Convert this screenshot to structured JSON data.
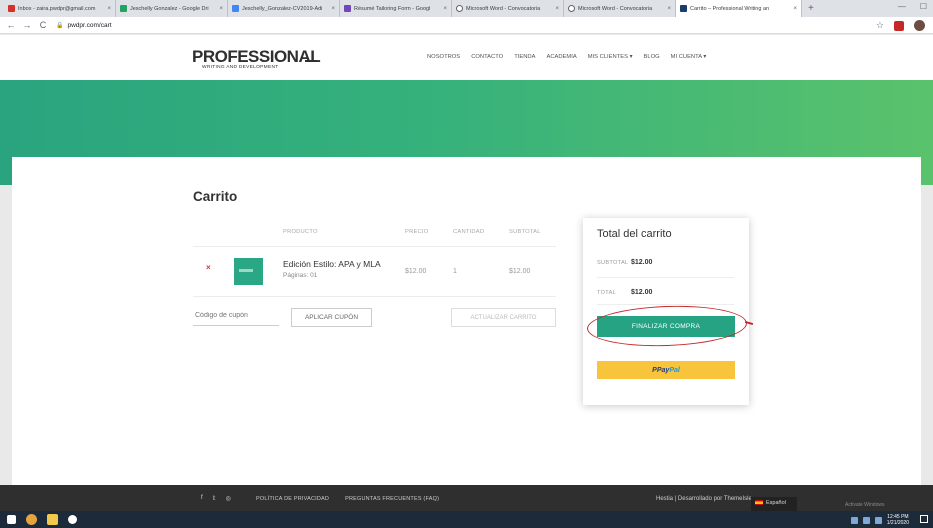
{
  "browser": {
    "tabs": [
      {
        "label": "Inbox - zaira.pwdpr@gmail.com",
        "color": "#d93025",
        "active": false
      },
      {
        "label": "Jeschelly Gonzalez - Google Dri",
        "color": "#1fa463",
        "active": false
      },
      {
        "label": "Jeschelly_Gonzalez-CV2019-Adi",
        "color": "#4285f4",
        "active": false
      },
      {
        "label": "Résumé Tailoring Form - Googl",
        "color": "#7248b9",
        "active": false
      },
      {
        "label": "Microsoft Word - Convocatoria",
        "color": "#5f6368",
        "active": false
      },
      {
        "label": "Microsoft Word - Convocatoria",
        "color": "#5f6368",
        "active": false
      },
      {
        "label": "Carrito – Professional Writing an",
        "color": "#1a3c6e",
        "active": true
      }
    ],
    "new_tab": "+",
    "url": "pwdpr.com/cart",
    "back": "←",
    "forward": "→",
    "reload": "C",
    "lock": "🔒",
    "star": "☆",
    "window_controls": [
      "—",
      "☐",
      "✕"
    ]
  },
  "site": {
    "logo_main": "PROFESSIONAL",
    "logo_sub": "WRITING AND DEVELOPMENT",
    "nav": [
      "NOSOTROS",
      "CONTACTO",
      "TIENDA",
      "ACADEMIA",
      "MIS CLIENTES ▾",
      "BLOG",
      "MI CUENTA ▾"
    ]
  },
  "cart": {
    "title": "Carrito",
    "headers": {
      "product": "PRODUCTO",
      "price": "PRECIO",
      "quantity": "CANTIDAD",
      "subtotal": "SUBTOTAL"
    },
    "item": {
      "remove": "×",
      "name": "Edición Estilo: APA y MLA",
      "meta": "Páginas: 01",
      "price": "$12.00",
      "quantity": "1",
      "subtotal": "$12.00"
    },
    "coupon_placeholder": "Código de cupón",
    "apply_coupon": "APLICAR CUPÓN",
    "update_cart": "ACTUALIZAR CARRITO"
  },
  "totals": {
    "title": "Total del carrito",
    "subtotal_label": "SUBTOTAL",
    "subtotal_value": "$12.00",
    "total_label": "TOTAL",
    "total_value": "$12.00",
    "checkout": "FINALIZAR COMPRA",
    "paypal_p": "P ",
    "paypal_pay": "Pay",
    "paypal_pal": "Pal"
  },
  "footer": {
    "social": [
      "f",
      "𝕥",
      "◎"
    ],
    "links": [
      "POLÍTICA DE PRIVACIDAD",
      "PREGUNTAS FRECUENTES (FAQ)"
    ],
    "credit": "Hestia | Desarrollado por ThemeIsle",
    "language": "Español",
    "activate_windows": "Activate Windows"
  },
  "taskbar": {
    "time": "12:45 PM",
    "date": "1/21/2020"
  },
  "colors": {
    "accent": "#25a383",
    "paypal": "#f7c43b",
    "annotation": "#c62828"
  }
}
